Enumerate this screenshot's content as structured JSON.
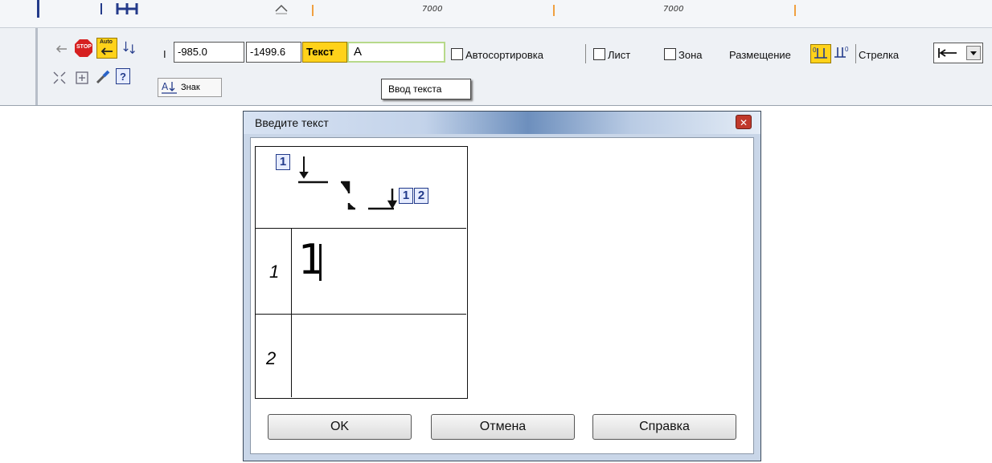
{
  "ruler": {
    "labels": [
      "7000",
      "7000"
    ]
  },
  "toolbar": {
    "x_value": "-985.0",
    "y_value": "-1499.6",
    "text_label": "Текст",
    "text_value": "A",
    "tooltip": "Ввод текста",
    "znak_label": "Знак",
    "autosort_label": "Автосортировка",
    "list_label": "Лист",
    "zone_label": "Зона",
    "placement_label": "Размещение",
    "arrow_label": "Стрелка",
    "auto_badge": "Auto",
    "stop_badge": "STOP"
  },
  "dialog": {
    "title": "Введите текст",
    "preview": {
      "left_mark": "1",
      "right_mark_1": "1",
      "right_mark_2": "2"
    },
    "rows": [
      {
        "num": "1",
        "value": "1"
      },
      {
        "num": "2",
        "value": ""
      }
    ],
    "ok": "OK",
    "cancel": "Отмена",
    "help": "Справка"
  }
}
